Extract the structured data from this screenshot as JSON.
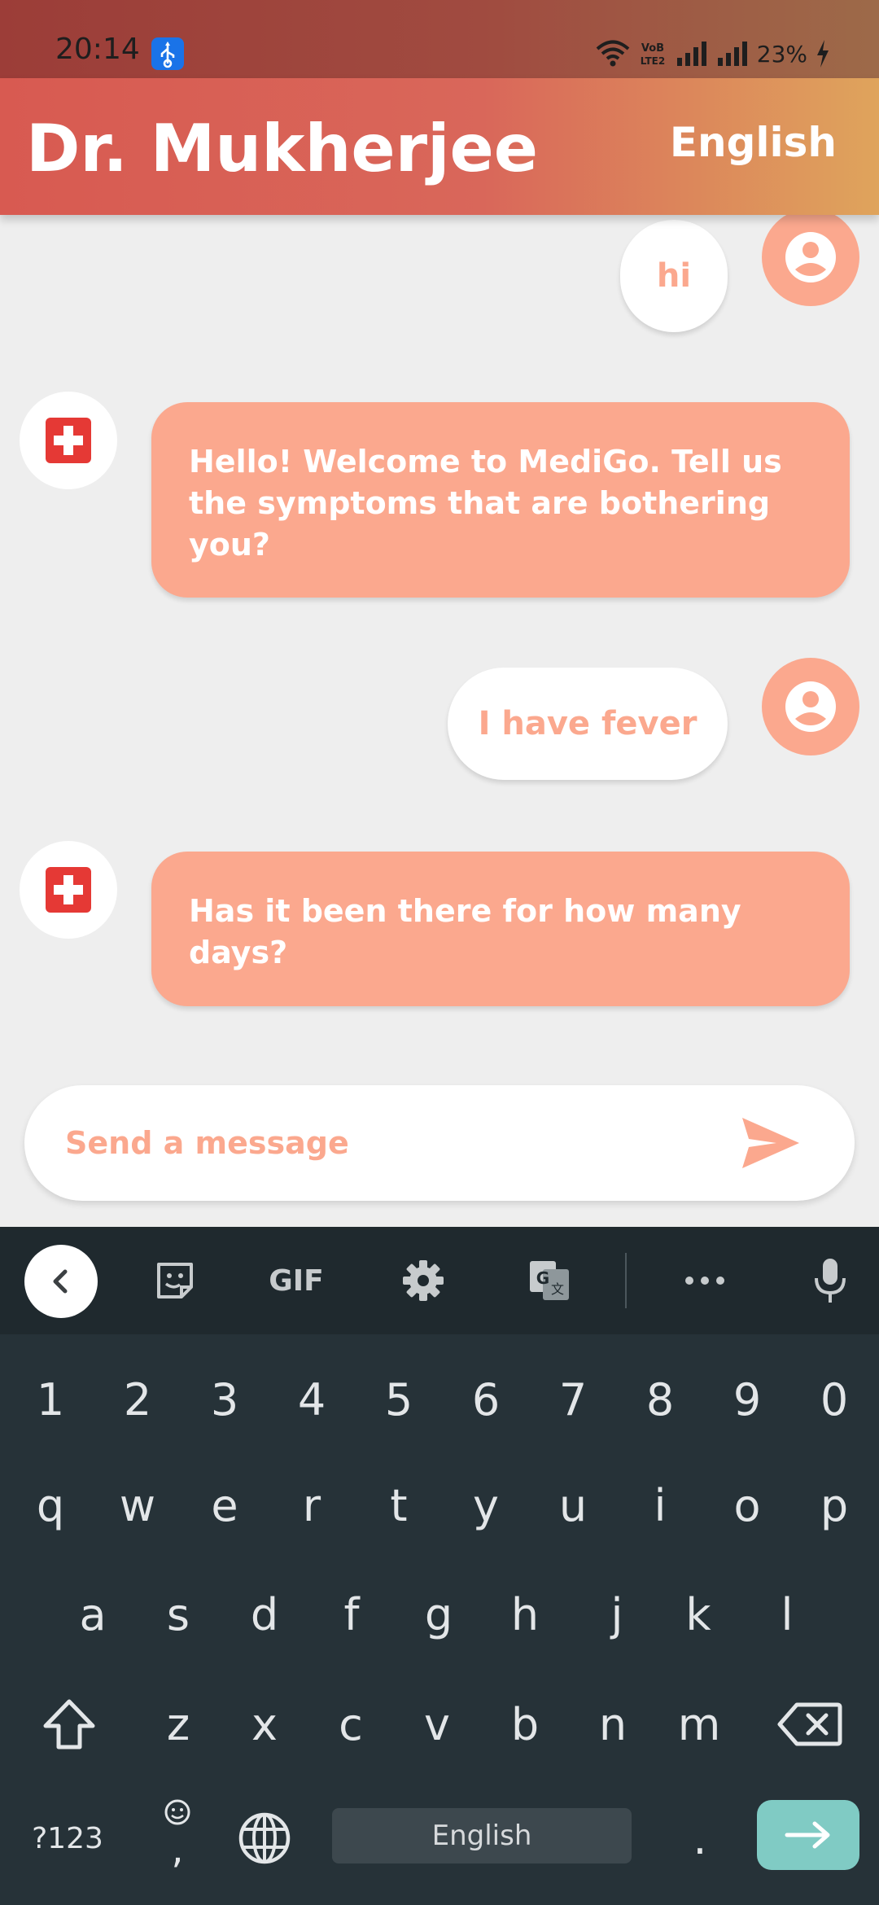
{
  "status_bar": {
    "time": "20:14",
    "network_label": "VoB LTE2",
    "battery": "23%"
  },
  "header": {
    "title": "Dr. Mukherjee",
    "language_button": "English"
  },
  "messages": [
    {
      "sender": "user",
      "text": "hi"
    },
    {
      "sender": "bot",
      "lines": [
        "Hello! Welcome to MediGo. Tell us",
        "the symptoms that are bothering",
        "you?"
      ]
    },
    {
      "sender": "user",
      "text": "I have fever"
    },
    {
      "sender": "bot",
      "lines": [
        "Has it been there for how many",
        "days?"
      ]
    }
  ],
  "composer": {
    "placeholder": "Send a message",
    "value": ""
  },
  "keyboard": {
    "toolbar": {
      "gif_label": "GIF",
      "icons": [
        "back-arrow-icon",
        "sticker-icon",
        "gif-icon",
        "settings-icon",
        "translate-icon",
        "more-icon",
        "microphone-icon"
      ]
    },
    "rows": [
      [
        "1",
        "2",
        "3",
        "4",
        "5",
        "6",
        "7",
        "8",
        "9",
        "0"
      ],
      [
        "q",
        "w",
        "e",
        "r",
        "t",
        "y",
        "u",
        "i",
        "o",
        "p"
      ],
      [
        "a",
        "s",
        "d",
        "f",
        "g",
        "h",
        "j",
        "k",
        "l"
      ],
      [
        "z",
        "x",
        "c",
        "v",
        "b",
        "n",
        "m"
      ]
    ],
    "symbols_key": "?123",
    "emoji_key": ",",
    "space_label": "English",
    "period_key": "."
  },
  "colors": {
    "accent": "#fba88e",
    "header_start": "#d85a51",
    "header_end": "#dfa45c",
    "bot_icon_red": "#e53935",
    "keyboard_bg": "#263238",
    "enter_key": "#80cbc4"
  }
}
